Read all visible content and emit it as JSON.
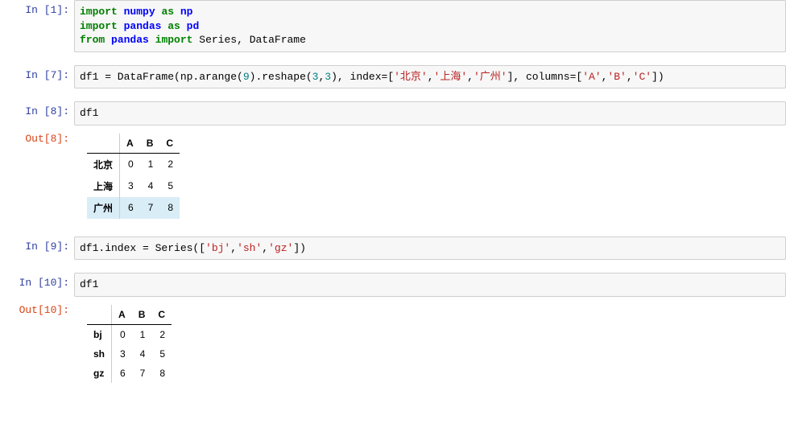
{
  "labels": {
    "in": "In",
    "out": "Out"
  },
  "cells": {
    "c1": {
      "num": 1
    },
    "c2": {
      "num": 7
    },
    "c3": {
      "num": 8
    },
    "c4": {
      "num": 9
    },
    "c5": {
      "num": 10
    }
  },
  "code": {
    "c1": {
      "l1": {
        "kw1": "import",
        "m1": "numpy",
        "kw2": "as",
        "a1": "np"
      },
      "l2": {
        "kw1": "import",
        "m1": "pandas",
        "kw2": "as",
        "a1": "pd"
      },
      "l3": {
        "kw1": "from",
        "m1": "pandas",
        "kw2": "import",
        "names": "Series, DataFrame"
      }
    },
    "c2": {
      "pre": "df1 = DataFrame(np.arange(",
      "n9": "9",
      "mid1": ").reshape(",
      "n3a": "3",
      "comma1": ",",
      "n3b": "3",
      "mid2": "), index=[",
      "s1": "'北京'",
      "c1": ",",
      "s2": "'上海'",
      "c2": ",",
      "s3": "'广州'",
      "mid3": "], columns=[",
      "sA": "'A'",
      "c3": ",",
      "sB": "'B'",
      "c4": ",",
      "sC": "'C'",
      "end": "])"
    },
    "c3": "df1",
    "c4": {
      "pre": "df1.index = Series([",
      "s1": "'bj'",
      "c1": ",",
      "s2": "'sh'",
      "c2": ",",
      "s3": "'gz'",
      "end": "])"
    },
    "c5": "df1"
  },
  "output": {
    "o3": {
      "cols": [
        "A",
        "B",
        "C"
      ],
      "rows": [
        {
          "idx": "北京",
          "vals": [
            "0",
            "1",
            "2"
          ],
          "hl": false
        },
        {
          "idx": "上海",
          "vals": [
            "3",
            "4",
            "5"
          ],
          "hl": false
        },
        {
          "idx": "广州",
          "vals": [
            "6",
            "7",
            "8"
          ],
          "hl": true
        }
      ]
    },
    "o5": {
      "cols": [
        "A",
        "B",
        "C"
      ],
      "rows": [
        {
          "idx": "bj",
          "vals": [
            "0",
            "1",
            "2"
          ],
          "hl": false
        },
        {
          "idx": "sh",
          "vals": [
            "3",
            "4",
            "5"
          ],
          "hl": false
        },
        {
          "idx": "gz",
          "vals": [
            "6",
            "7",
            "8"
          ],
          "hl": false
        }
      ]
    }
  }
}
